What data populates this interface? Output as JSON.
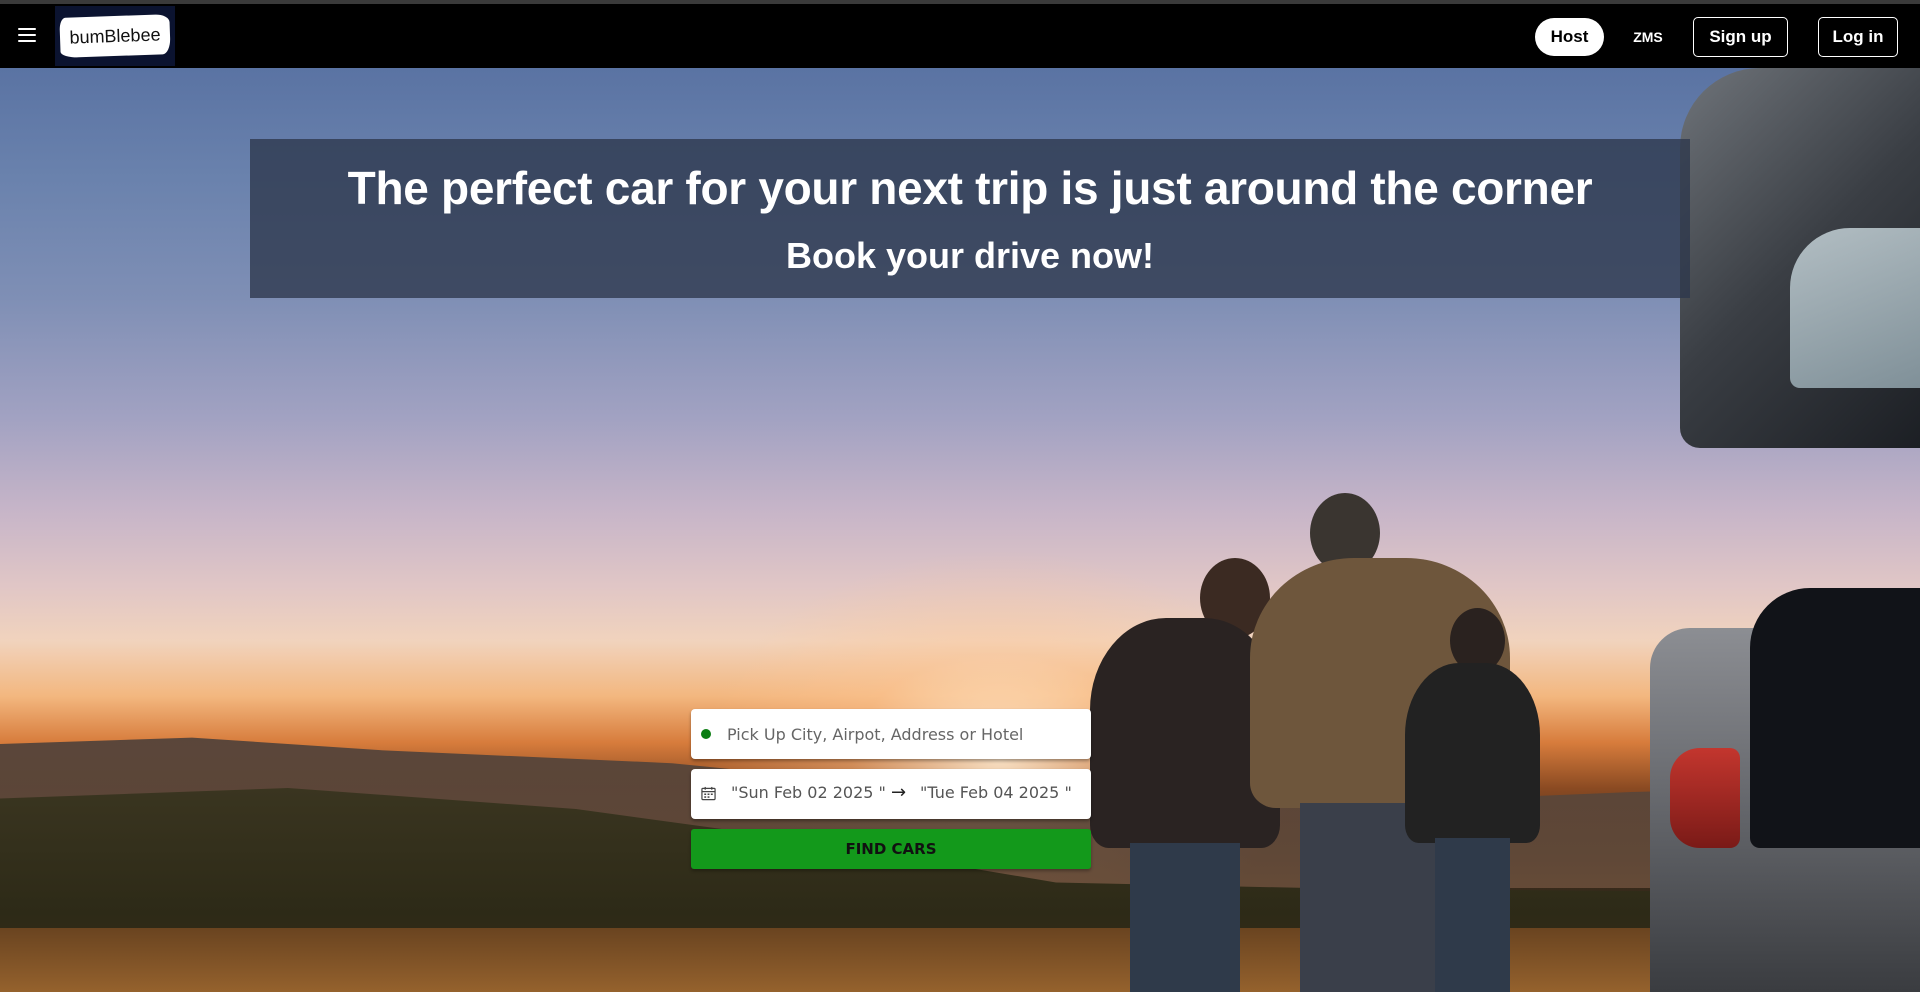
{
  "nav": {
    "menu_icon": "hamburger-menu-icon",
    "logo_text": "bumBlebee",
    "host_label": "Host",
    "zms_label": "ZMS",
    "signup_label": "Sign up",
    "login_label": "Log in"
  },
  "hero": {
    "title": "The perfect car for your next trip is just around the corner",
    "subtitle": "Book your drive now!"
  },
  "search": {
    "location_placeholder": "Pick Up City, Airpot, Address or Hotel",
    "start_date": "\"Sun Feb 02 2025 \"",
    "end_date": "\"Tue Feb 04 2025 \"",
    "arrow": "→",
    "find_label": "FIND CARS"
  },
  "colors": {
    "find_button": "#13991b",
    "location_dot": "#0a7d12",
    "navbar": "#000000"
  }
}
